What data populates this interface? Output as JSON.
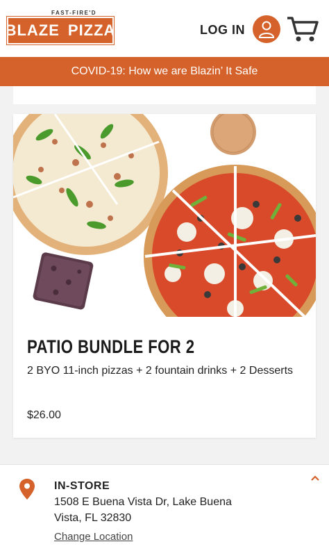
{
  "header": {
    "logo_tagline": "FAST-FIRE'D",
    "logo_word_left": "BLAZE",
    "logo_word_right": "PIZZA",
    "login_label": "LOG IN",
    "icons": [
      "user-icon",
      "cart-icon"
    ]
  },
  "banner": {
    "text": "COVID-19: How we are Blazin’ It Safe"
  },
  "product": {
    "title": "PATIO BUNDLE FOR 2",
    "description": "2 BYO 11-inch pizzas + 2 fountain drinks + 2 Desserts",
    "price": "$26.00"
  },
  "location": {
    "mode": "IN-STORE",
    "address": "1508 E Buena Vista Dr, Lake Buena Vista, FL 32830",
    "change_label": "Change Location"
  },
  "colors": {
    "brand": "#d4622a",
    "background": "#f2f2f2",
    "card": "#ffffff"
  }
}
